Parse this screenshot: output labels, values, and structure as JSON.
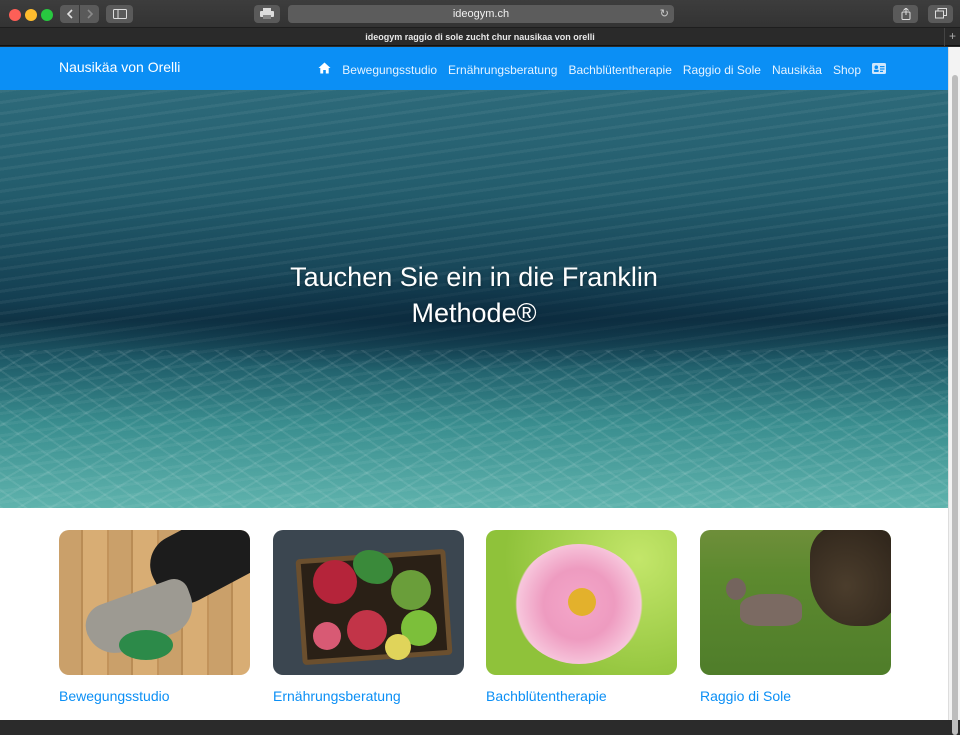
{
  "browser": {
    "url": "ideogym.ch",
    "tab_title": "ideogym raggio di sole zucht chur nausikaa von orelli",
    "back_icon": "chevron-left-icon",
    "forward_icon": "chevron-right-icon",
    "sidebar_icon": "sidebar-icon",
    "print_icon": "printer-icon",
    "reload_icon": "reload-icon",
    "share_icon": "share-icon",
    "tabs_icon": "tabs-icon",
    "new_tab_label": "+"
  },
  "site": {
    "brand": "Nausikäa von Orelli",
    "nav_color": "#0b8ff5",
    "menu": [
      "Bewegungsstudio",
      "Ernährungsberatung",
      "Bachblütentherapie",
      "Raggio di Sole",
      "Nausikäa",
      "Shop"
    ],
    "home_icon": "home-icon",
    "contact_icon": "contact-card-icon"
  },
  "hero": {
    "title": "Tauchen Sie ein in die Franklin Methode®"
  },
  "cards": [
    {
      "title": "Bewegungsstudio"
    },
    {
      "title": "Ernährungsberatung"
    },
    {
      "title": "Bachblütentherapie"
    },
    {
      "title": "Raggio di Sole"
    }
  ]
}
